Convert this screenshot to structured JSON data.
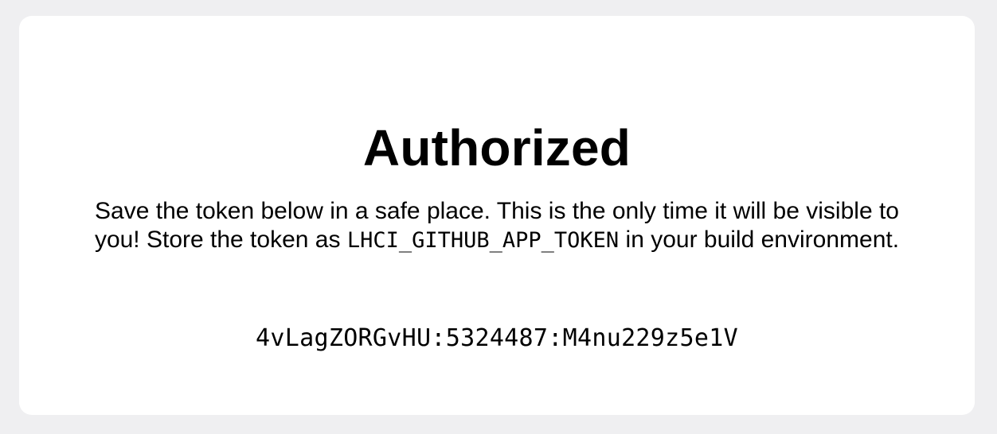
{
  "heading": "Authorized",
  "message": {
    "before_code": "Save the token below in a safe place. This is the only time it will be visible to you! Store the token as ",
    "env_var": "LHCI_GITHUB_APP_TOKEN",
    "after_code": " in your build environment."
  },
  "token": "4vLagZORGvHU:5324487:M4nu229z5e1V"
}
